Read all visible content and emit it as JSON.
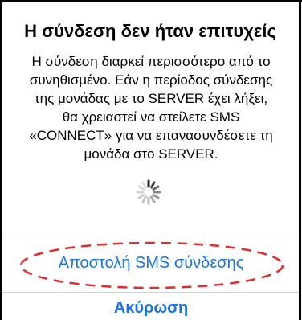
{
  "alert": {
    "title": "Η σύνδεση δεν ήταν επιτυχείς",
    "message_lines": [
      "Η σύνδεση διαρκεί περισσότερο από το",
      "συνηθισμένο. Εάν η περίοδος σύνδεσης",
      "της μονάδας με το SERVER έχει λήξει,",
      "θα χρειαστεί να στείλετε SMS",
      "«CONNECT» για να επανασυνδέσετε τη",
      "μονάδα στο SERVER."
    ],
    "loading_icon": "activity-spinner-icon"
  },
  "actions": {
    "send_sms_label": "Αποστολή SMS σύνδεσης",
    "cancel_label": "Ακύρωση"
  },
  "colors": {
    "action_blue": "#1a73e8",
    "highlight_red": "#e32b2b",
    "divider": "#d1d1d6"
  }
}
